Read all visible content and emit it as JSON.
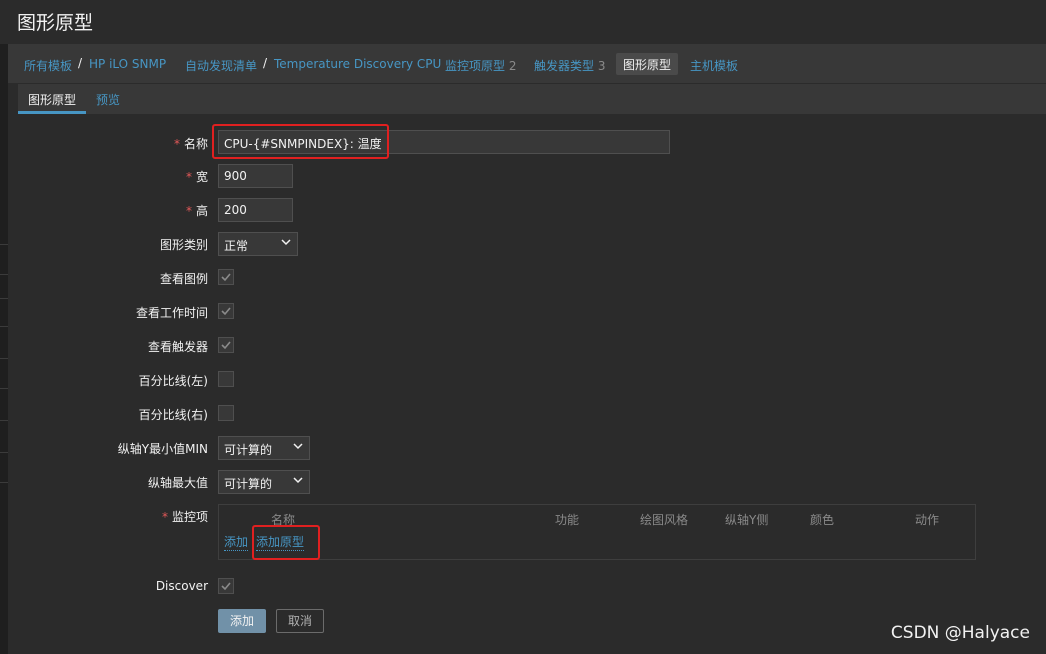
{
  "header": {
    "title": "图形原型"
  },
  "breadcrumb": {
    "items": [
      {
        "label": "所有模板"
      },
      {
        "label": "HP iLO SNMP"
      },
      {
        "label": "自动发现清单"
      },
      {
        "label": "Temperature Discovery CPU"
      },
      {
        "label": "监控项原型",
        "count": "2"
      },
      {
        "label": "触发器类型",
        "count": "3"
      },
      {
        "label": "图形原型"
      },
      {
        "label": "主机模板"
      }
    ],
    "separator": "/"
  },
  "tabs": [
    {
      "label": "图形原型",
      "active": true
    },
    {
      "label": "预览",
      "active": false
    }
  ],
  "form": {
    "name": {
      "label": "名称",
      "value": "CPU-{#SNMPINDEX}: 温度",
      "required": true
    },
    "width": {
      "label": "宽",
      "value": "900",
      "required": true
    },
    "height": {
      "label": "高",
      "value": "200",
      "required": true
    },
    "graph_type": {
      "label": "图形类别",
      "value": "正常"
    },
    "show_legend": {
      "label": "查看图例",
      "checked": true
    },
    "show_work_period": {
      "label": "查看工作时间",
      "checked": true
    },
    "show_triggers": {
      "label": "查看触发器",
      "checked": true
    },
    "percentile_left": {
      "label": "百分比线(左)",
      "checked": false
    },
    "percentile_right": {
      "label": "百分比线(右)",
      "checked": false
    },
    "ymin": {
      "label": "纵轴Y最小值MIN",
      "value": "可计算的"
    },
    "ymax": {
      "label": "纵轴最大值",
      "value": "可计算的"
    },
    "items": {
      "label": "监控项",
      "required": true,
      "columns": [
        "名称",
        "功能",
        "绘图风格",
        "纵轴Y侧",
        "颜色",
        "动作"
      ],
      "add_link": "添加",
      "add_prototype_link": "添加原型"
    },
    "discover": {
      "label": "Discover",
      "checked": true
    }
  },
  "buttons": {
    "add": "添加",
    "cancel": "取消"
  },
  "watermark": "CSDN @Halyace",
  "colors": {
    "accent": "#4796c4",
    "highlight": "#e02020",
    "required": "#e45959"
  },
  "icons": {
    "checkbox": "checkmark-icon",
    "dropdown": "chevron-down-icon"
  }
}
